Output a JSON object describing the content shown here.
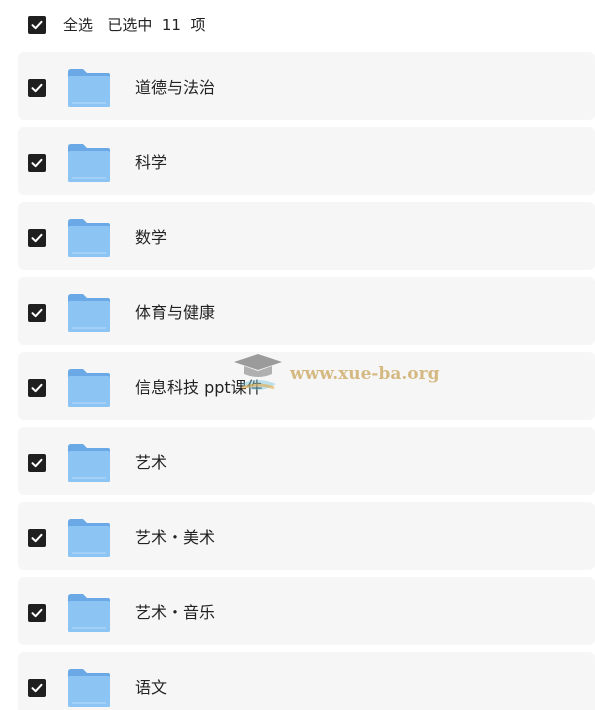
{
  "header": {
    "select_all": "全选",
    "selected_prefix": "已选中",
    "selected_count": "11",
    "selected_suffix": "项"
  },
  "folders": [
    {
      "name": "道德与法治"
    },
    {
      "name": "科学"
    },
    {
      "name": "数学"
    },
    {
      "name": "体育与健康"
    },
    {
      "name": "信息科技 ppt课件"
    },
    {
      "name": "艺术"
    },
    {
      "name": "艺术・美术"
    },
    {
      "name": "艺术・音乐"
    },
    {
      "name": "语文"
    }
  ],
  "icons": {
    "checkbox": "checkbox-checked-icon",
    "folder": "folder-icon"
  },
  "colors": {
    "checkbox_fill": "#1f1f1f",
    "row_background": "#f6f6f7",
    "folder_blue": "#7fb8ee"
  },
  "watermark": {
    "text": "www.xue-ba.org"
  }
}
